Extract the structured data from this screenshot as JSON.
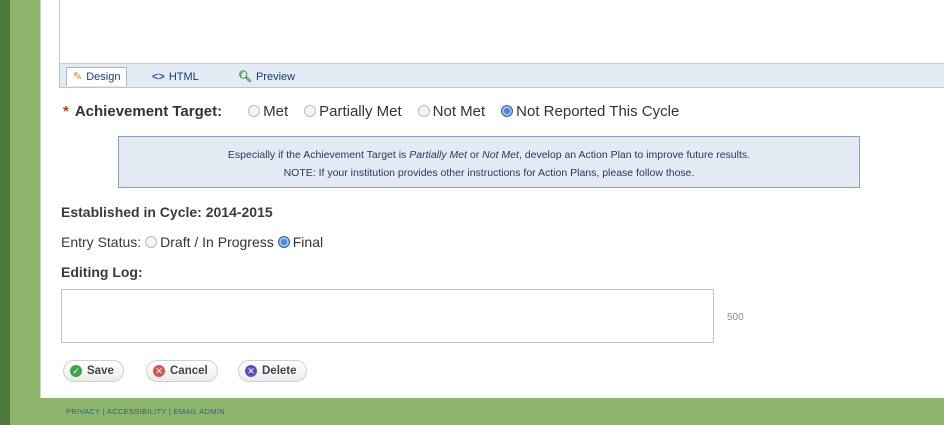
{
  "editor": {
    "tabs": [
      {
        "label": "Design",
        "icon": "pencil-icon"
      },
      {
        "label": "HTML",
        "icon": "code-icon"
      },
      {
        "label": "Preview",
        "icon": "magnifier-icon"
      }
    ]
  },
  "achievement": {
    "label": "Achievement Target:",
    "options": [
      "Met",
      "Partially Met",
      "Not Met",
      "Not Reported This Cycle"
    ],
    "selected": "Not Reported This Cycle"
  },
  "notice": {
    "line1_before": "Especially if the Achievement Target is ",
    "line1_em1": "Partially Met",
    "line1_mid": " or ",
    "line1_em2": "Not Met",
    "line1_after": ", develop an Action Plan to improve future results.",
    "line2": "NOTE: If your institution provides other instructions for Action Plans, please follow those."
  },
  "cycle": {
    "text": "Established in Cycle: 2014-2015"
  },
  "entry_status": {
    "label": "Entry Status:",
    "options": [
      "Draft / In Progress",
      "Final"
    ],
    "selected": "Final"
  },
  "editing_log": {
    "label": "Editing Log:",
    "value": "",
    "counter": "500"
  },
  "buttons": {
    "save": "Save",
    "cancel": "Cancel",
    "delete": "Delete"
  },
  "footer": {
    "links": "PRIVACY | ACCESSIBILITY | EMAIL ADMIN"
  },
  "colors": {
    "accent": "#4a86d6",
    "required": "#c0392b",
    "frame": "#8cb46a"
  }
}
